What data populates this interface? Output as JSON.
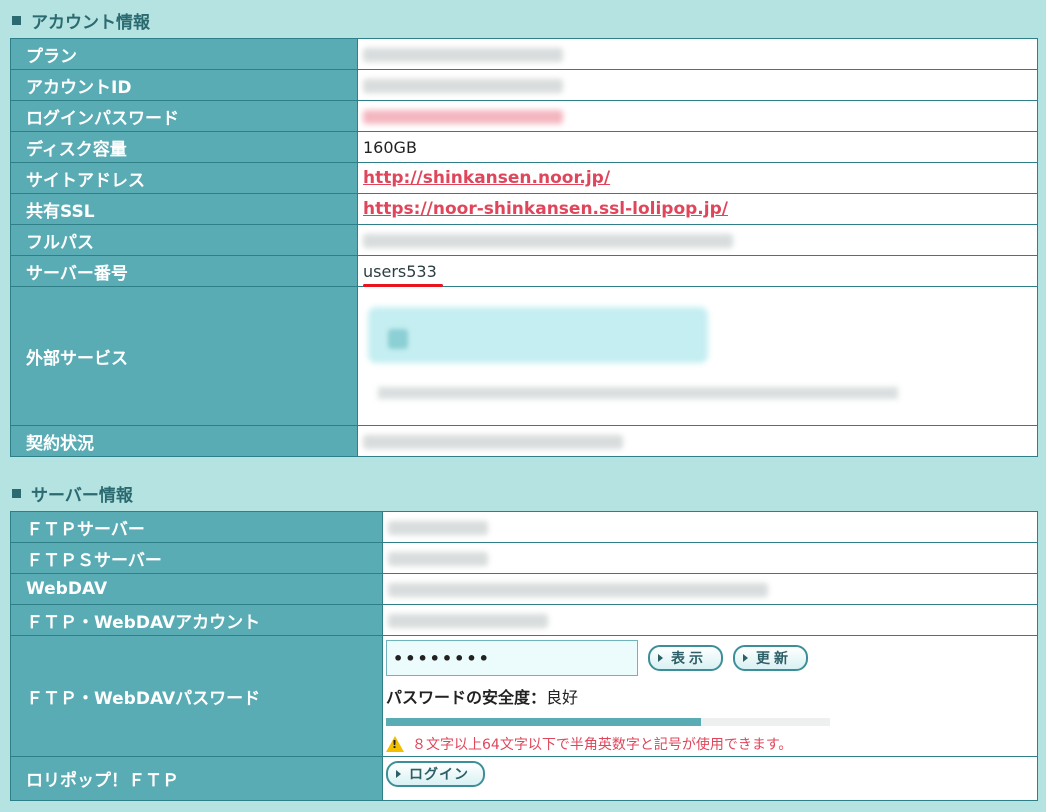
{
  "account_section": {
    "title": "アカウント情報",
    "rows": {
      "plan": "プラン",
      "account_id": "アカウントID",
      "login_password": "ログインパスワード",
      "disk": "ディスク容量",
      "disk_value": "160GB",
      "site_address": "サイトアドレス",
      "site_address_value": "http://shinkansen.noor.jp/",
      "shared_ssl": "共有SSL",
      "shared_ssl_value": "https://noor-shinkansen.ssl-lolipop.jp/",
      "full_path": "フルパス",
      "server_number": "サーバー番号",
      "server_number_value": "users533",
      "external_service": "外部サービス",
      "contract_status": "契約状況"
    }
  },
  "server_section": {
    "title": "サーバー情報",
    "rows": {
      "ftp_server": "ＦＴＰサーバー",
      "ftps_server": "ＦＴＰＳサーバー",
      "webdav": "WebDAV",
      "ftp_webdav_account": "ＦＴＰ・WebDAVアカウント",
      "ftp_webdav_password": "ＦＴＰ・WebDAVパスワード",
      "password_value": "••••••••",
      "show_button": "表示",
      "update_button": "更新",
      "strength_label": "パスワードの安全度：",
      "strength_value": "良好",
      "strength_level": 0.71,
      "warning_text": "８文字以上64文字以下で半角英数字と記号が使用できます。",
      "lolipop_ftp": "ロリポップ！ＦＴＰ",
      "login_button": "ログイン"
    }
  },
  "colors": {
    "background": "#b5e3e1",
    "header_cell": "#5aacb4",
    "link": "#e0465b",
    "underline": "#e8151f"
  },
  "icons": {
    "warning": "warning-triangle-icon",
    "button_arrow": "arrow-right-icon"
  }
}
